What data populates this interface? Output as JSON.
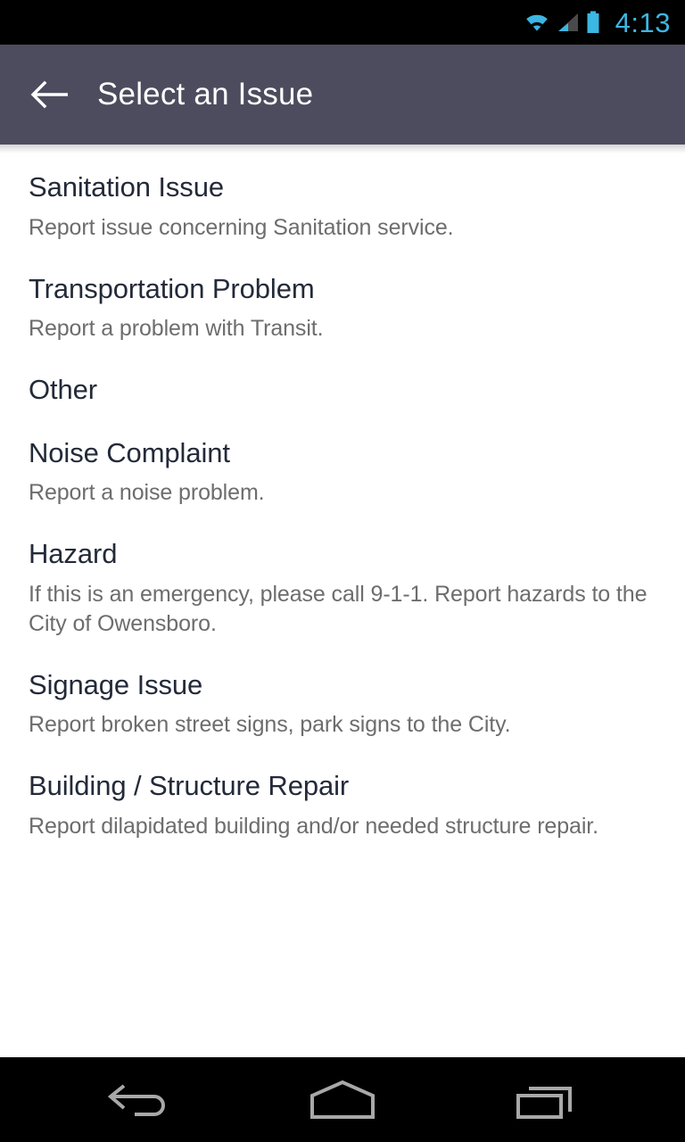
{
  "status_bar": {
    "time": "4:13",
    "icons": [
      "wifi-icon",
      "signal-icon",
      "battery-icon"
    ],
    "accent_color": "#3cb6e3",
    "background": "#000000"
  },
  "action_bar": {
    "title": "Select an Issue",
    "back_icon": "back-arrow-icon",
    "background": "#4c4c5e",
    "title_color": "#ffffff"
  },
  "list": {
    "items": [
      {
        "title": "Sanitation Issue",
        "subtitle": "Report issue concerning Sanitation service."
      },
      {
        "title": "Transportation Problem",
        "subtitle": "Report a problem with Transit."
      },
      {
        "title": "Other",
        "subtitle": ""
      },
      {
        "title": "Noise Complaint",
        "subtitle": "Report a noise problem."
      },
      {
        "title": "Hazard",
        "subtitle": "If this is an emergency, please call 9-1-1.  Report hazards to the City of Owensboro."
      },
      {
        "title": "Signage Issue",
        "subtitle": "Report broken street signs, park signs to the City."
      },
      {
        "title": "Building / Structure Repair",
        "subtitle": "Report dilapidated building and/or needed structure repair."
      }
    ],
    "title_color": "#232a39",
    "subtitle_color": "#6d6d6d",
    "background": "#ffffff"
  },
  "nav_bar": {
    "buttons": [
      {
        "name": "back-nav-icon"
      },
      {
        "name": "home-nav-icon"
      },
      {
        "name": "recents-nav-icon"
      }
    ],
    "background": "#000000",
    "icon_color": "#a8a8a8"
  }
}
